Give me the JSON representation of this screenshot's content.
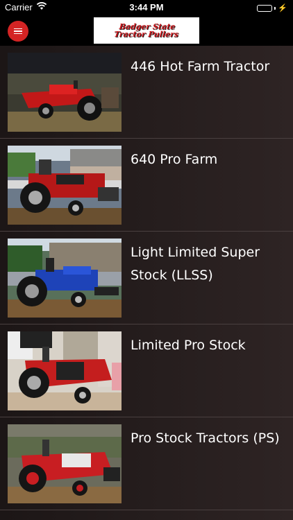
{
  "status_bar": {
    "carrier": "Carrier",
    "time": "3:44 PM",
    "wifi_icon": "wifi-icon",
    "battery_icon": "battery-icon",
    "battery_level": 0.9,
    "battery_color": "#4cd964"
  },
  "nav": {
    "menu_icon": "hamburger-menu-icon",
    "menu_button_color": "#d42424",
    "logo": {
      "line1": "Badger State",
      "line2": "Tractor Pullers"
    }
  },
  "classes": [
    {
      "title": "446 Hot Farm Tractor",
      "image": "red-farm-tractor-photo"
    },
    {
      "title": "640 Pro Farm",
      "image": "red-pro-farm-tractor-photo"
    },
    {
      "title": "Light Limited Super Stock (LLSS)",
      "image": "blue-super-stock-tractor-photo"
    },
    {
      "title": "Limited Pro Stock",
      "image": "red-limited-pro-stock-tractor-photo"
    },
    {
      "title": "Pro Stock Tractors (PS)",
      "image": "red-pro-stock-tractor-photo"
    }
  ]
}
